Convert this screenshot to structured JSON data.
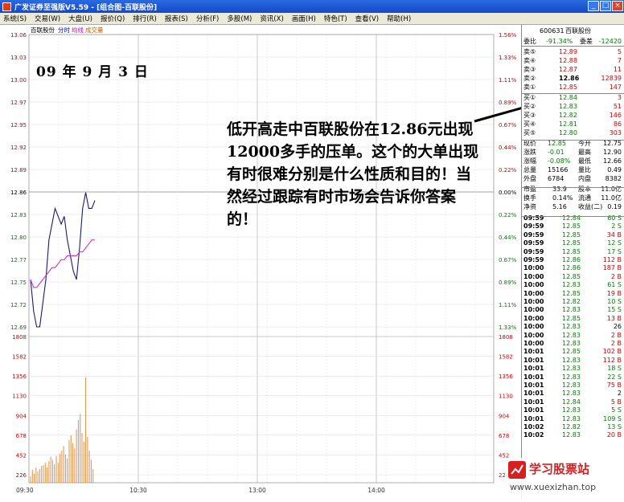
{
  "window": {
    "title": "广发证券至强版V5.59 - [组合图-百联股份]",
    "min": "_",
    "max": "□",
    "close": "×"
  },
  "menu": [
    "系统(S)",
    "交易(W)",
    "大盘(U)",
    "报价(Q)",
    "排行(R)",
    "报表(S)",
    "分析(F)",
    "多股(M)",
    "资讯(X)",
    "画面(H)",
    "特色(T)",
    "查看(V)",
    "帮助(H)"
  ],
  "chart": {
    "stock_label": "百联股份",
    "legend": {
      "time": "分时",
      "avg": "均线",
      "vol": "成交量"
    },
    "date_text": "09 年 9 月 3 日",
    "price_ticks": [
      "13.06",
      "13.03",
      "13.00",
      "12.97",
      "12.95",
      "12.92",
      "12.89",
      "12.86",
      "12.83",
      "12.80",
      "12.77",
      "12.75",
      "12.72",
      "12.69"
    ],
    "pct_ticks": [
      "1.56%",
      "1.33%",
      "1.11%",
      "0.89%",
      "0.67%",
      "0.44%",
      "0.22%",
      "0.00%",
      "0.22%",
      "0.44%",
      "0.67%",
      "0.89%",
      "1.11%",
      "1.33%"
    ],
    "vol_ticks": [
      "1808",
      "1582",
      "1356",
      "1130",
      "904",
      "678",
      "452",
      "226"
    ],
    "time_ticks": [
      "09:30",
      "10:30",
      "13:00",
      "14:00"
    ],
    "annotation": "低开高走中百联股份在12.86元出现12000多手的压单。这个的大单出现有时很难分别是什么性质和目的！当然经过跟踪有时市场会告诉你答案的！",
    "price_line": [
      12.75,
      12.71,
      12.69,
      12.69,
      12.72,
      12.75,
      12.8,
      12.82,
      12.84,
      12.83,
      12.82,
      12.83,
      12.8,
      12.78,
      12.76,
      12.75,
      12.79,
      12.84,
      12.86,
      12.84,
      12.84,
      12.85
    ],
    "avg_line": [
      12.75,
      12.74,
      12.74,
      12.745,
      12.75,
      12.755,
      12.76,
      12.765,
      12.765,
      12.77,
      12.775,
      12.775,
      12.78,
      12.78,
      12.78,
      12.78,
      12.785,
      12.785,
      12.79,
      12.795,
      12.8,
      12.8
    ],
    "volumes": [
      80,
      170,
      120,
      200,
      150,
      180,
      220,
      230,
      260,
      200,
      280,
      340,
      300,
      240,
      350,
      260,
      380,
      420,
      480,
      370,
      320,
      560,
      620,
      520,
      450,
      700,
      820,
      900,
      650,
      540,
      1380,
      600,
      420,
      300,
      180
    ]
  },
  "quote": {
    "code": "600631",
    "name": "百联股份",
    "wb_label": "委比",
    "wb_val": "-91.34%",
    "wc_label": "委差",
    "wc_val": "-12420",
    "sells": [
      {
        "l": "卖⑤",
        "p": "12.89",
        "v": "5"
      },
      {
        "l": "卖④",
        "p": "12.88",
        "v": "7"
      },
      {
        "l": "卖③",
        "p": "12.87",
        "v": "11"
      },
      {
        "l": "卖②",
        "p": "12.86",
        "v": "12839"
      },
      {
        "l": "卖①",
        "p": "12.85",
        "v": "147"
      }
    ],
    "buys": [
      {
        "l": "买①",
        "p": "12.84",
        "v": "3"
      },
      {
        "l": "买②",
        "p": "12.83",
        "v": "51"
      },
      {
        "l": "买③",
        "p": "12.82",
        "v": "146"
      },
      {
        "l": "买④",
        "p": "12.81",
        "v": "86"
      },
      {
        "l": "买⑤",
        "p": "12.80",
        "v": "303"
      }
    ],
    "stats": [
      {
        "a": "现价",
        "b": "12.85",
        "c": "今开",
        "d": "12.75"
      },
      {
        "a": "涨跌",
        "b": "-0.01",
        "c": "最高",
        "d": "12.90"
      },
      {
        "a": "涨幅",
        "b": "-0.08%",
        "c": "最低",
        "d": "12.66"
      },
      {
        "a": "总量",
        "b": "15166",
        "c": "量比",
        "d": "0.49"
      },
      {
        "a": "外盘",
        "b": "6784",
        "c": "内盘",
        "d": "8382"
      }
    ],
    "stats2": [
      {
        "a": "市盈",
        "b": "33.9",
        "c": "股本",
        "d": "11.0亿"
      },
      {
        "a": "换手",
        "b": "0.14%",
        "c": "流通",
        "d": "11.0亿"
      },
      {
        "a": "净资",
        "b": "5.16",
        "c": "收益(二)",
        "d": "0.19"
      }
    ],
    "ticks": [
      [
        "09:59",
        "12.84",
        "60",
        "S"
      ],
      [
        "09:59",
        "12.85",
        "2",
        "S"
      ],
      [
        "09:59",
        "12.85",
        "34",
        "B"
      ],
      [
        "09:59",
        "12.85",
        "12",
        "S"
      ],
      [
        "09:59",
        "12.85",
        "17",
        "S"
      ],
      [
        "09:59",
        "12.86",
        "112",
        "B"
      ],
      [
        "10:00",
        "12.86",
        "187",
        "B"
      ],
      [
        "10:00",
        "12.85",
        "2",
        "B"
      ],
      [
        "10:00",
        "12.83",
        "61",
        "S"
      ],
      [
        "10:00",
        "12.85",
        "19",
        "B"
      ],
      [
        "10:00",
        "12.82",
        "10",
        "S"
      ],
      [
        "10:00",
        "12.83",
        "15",
        "S"
      ],
      [
        "10:00",
        "12.85",
        "13",
        "B"
      ],
      [
        "10:00",
        "12.83",
        "26",
        ""
      ],
      [
        "10:00",
        "12.83",
        "2",
        "B"
      ],
      [
        "10:00",
        "12.83",
        "2",
        "B"
      ],
      [
        "10:01",
        "12.85",
        "102",
        "B"
      ],
      [
        "10:01",
        "12.83",
        "112",
        "B"
      ],
      [
        "10:01",
        "12.83",
        "18",
        "S"
      ],
      [
        "10:01",
        "12.83",
        "22",
        "S"
      ],
      [
        "10:01",
        "12.83",
        "75",
        "B"
      ],
      [
        "10:01",
        "12.83",
        "2",
        ""
      ],
      [
        "10:01",
        "12.84",
        "5",
        "B"
      ],
      [
        "10:01",
        "12.83",
        "5",
        "S"
      ],
      [
        "10:01",
        "12.83",
        "109",
        "S"
      ],
      [
        "10:02",
        "12.82",
        "13",
        "S"
      ],
      [
        "10:02",
        "12.83",
        "20",
        "B"
      ]
    ]
  },
  "watermark": {
    "name": "学习股票站",
    "url": "www.xuexizhan.top"
  }
}
